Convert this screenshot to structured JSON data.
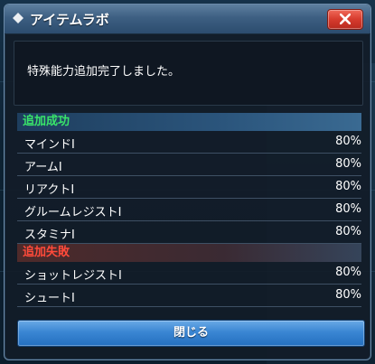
{
  "window": {
    "title": "アイテムラボ",
    "close_icon": "close-icon"
  },
  "message": "特殊能力追加完了しました。",
  "sections": [
    {
      "header": "追加成功",
      "items": [
        {
          "name": "マインドⅠ",
          "percent": "80%"
        },
        {
          "name": "アームⅠ",
          "percent": "80%"
        },
        {
          "name": "リアクトⅠ",
          "percent": "80%"
        },
        {
          "name": "グルームレジストⅠ",
          "percent": "80%"
        },
        {
          "name": "スタミナⅠ",
          "percent": "80%"
        }
      ]
    },
    {
      "header": "追加失敗",
      "items": [
        {
          "name": "ショットレジストⅠ",
          "percent": "80%"
        },
        {
          "name": "シュートⅠ",
          "percent": "80%"
        }
      ]
    }
  ],
  "buttons": {
    "close_label": "閉じる"
  },
  "colors": {
    "success": "#39e46a",
    "failure": "#ff4a3a",
    "accent": "#3a86d3",
    "close": "#d63b2d"
  }
}
